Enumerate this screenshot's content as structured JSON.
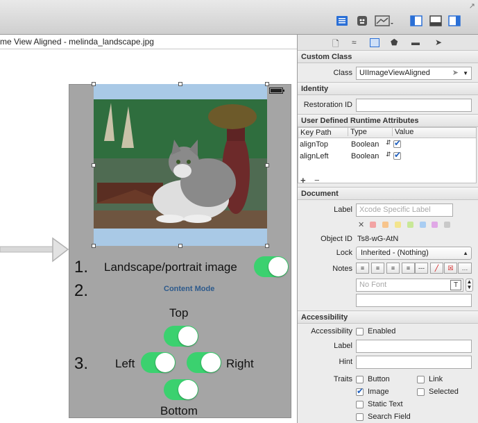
{
  "editor": {
    "jumpbar_text": "me View Aligned - melinda_landscape.jpg",
    "canvas": {
      "row1_number": "1.",
      "row1_label": "Landscape/portrait image",
      "row2_number": "2.",
      "row2_label": "Content Mode",
      "row3_number": "3.",
      "top_label": "Top",
      "left_label": "Left",
      "right_label": "Right",
      "bottom_label": "Bottom",
      "toggles": {
        "landscape_portrait": true,
        "top": true,
        "left": true,
        "right": true,
        "bottom": true
      }
    }
  },
  "toolbar": {
    "icons": [
      "standard-editor-icon",
      "assistant-editor-icon",
      "version-editor-icon",
      "navigator-toggle-icon",
      "debug-area-toggle-icon",
      "utilities-toggle-icon"
    ]
  },
  "inspector": {
    "tabs": [
      "file-inspector-icon",
      "quick-help-icon",
      "identity-inspector-icon",
      "attributes-inspector-icon",
      "size-inspector-icon",
      "connections-inspector-icon"
    ],
    "custom_class": {
      "header": "Custom Class",
      "class_label": "Class",
      "class_value": "UIImageViewAligned"
    },
    "identity": {
      "header": "Identity",
      "restoration_id_label": "Restoration ID",
      "restoration_id_value": ""
    },
    "runtime_attrs": {
      "header": "User Defined Runtime Attributes",
      "col_key": "Key Path",
      "col_type": "Type",
      "col_value": "Value",
      "rows": [
        {
          "key": "alignTop",
          "type": "Boolean",
          "value": true
        },
        {
          "key": "alignLeft",
          "type": "Boolean",
          "value": true
        }
      ],
      "add": "+",
      "remove": "−"
    },
    "document": {
      "header": "Document",
      "label_label": "Label",
      "label_placeholder": "Xcode Specific Label",
      "swatches": [
        "#f2a3a3",
        "#f7c48c",
        "#f3e48d",
        "#c8e897",
        "#a9cdf2",
        "#e0a8e6",
        "#c9c9c9"
      ],
      "object_id_label": "Object ID",
      "object_id_value": "Ts8-wG-AtN",
      "lock_label": "Lock",
      "lock_value": "Inherited - (Nothing)",
      "notes_label": "Notes",
      "notes_font_placeholder": "No Font"
    },
    "accessibility": {
      "header": "Accessibility",
      "accessibility_label": "Accessibility",
      "enabled_label": "Enabled",
      "enabled": false,
      "label_label": "Label",
      "hint_label": "Hint",
      "traits_label": "Traits",
      "traits": {
        "button": {
          "label": "Button",
          "checked": false
        },
        "link": {
          "label": "Link",
          "checked": false
        },
        "image": {
          "label": "Image",
          "checked": true
        },
        "selected": {
          "label": "Selected",
          "checked": false
        },
        "static_text": {
          "label": "Static Text",
          "checked": false
        },
        "search_field": {
          "label": "Search Field",
          "checked": false
        }
      }
    }
  }
}
